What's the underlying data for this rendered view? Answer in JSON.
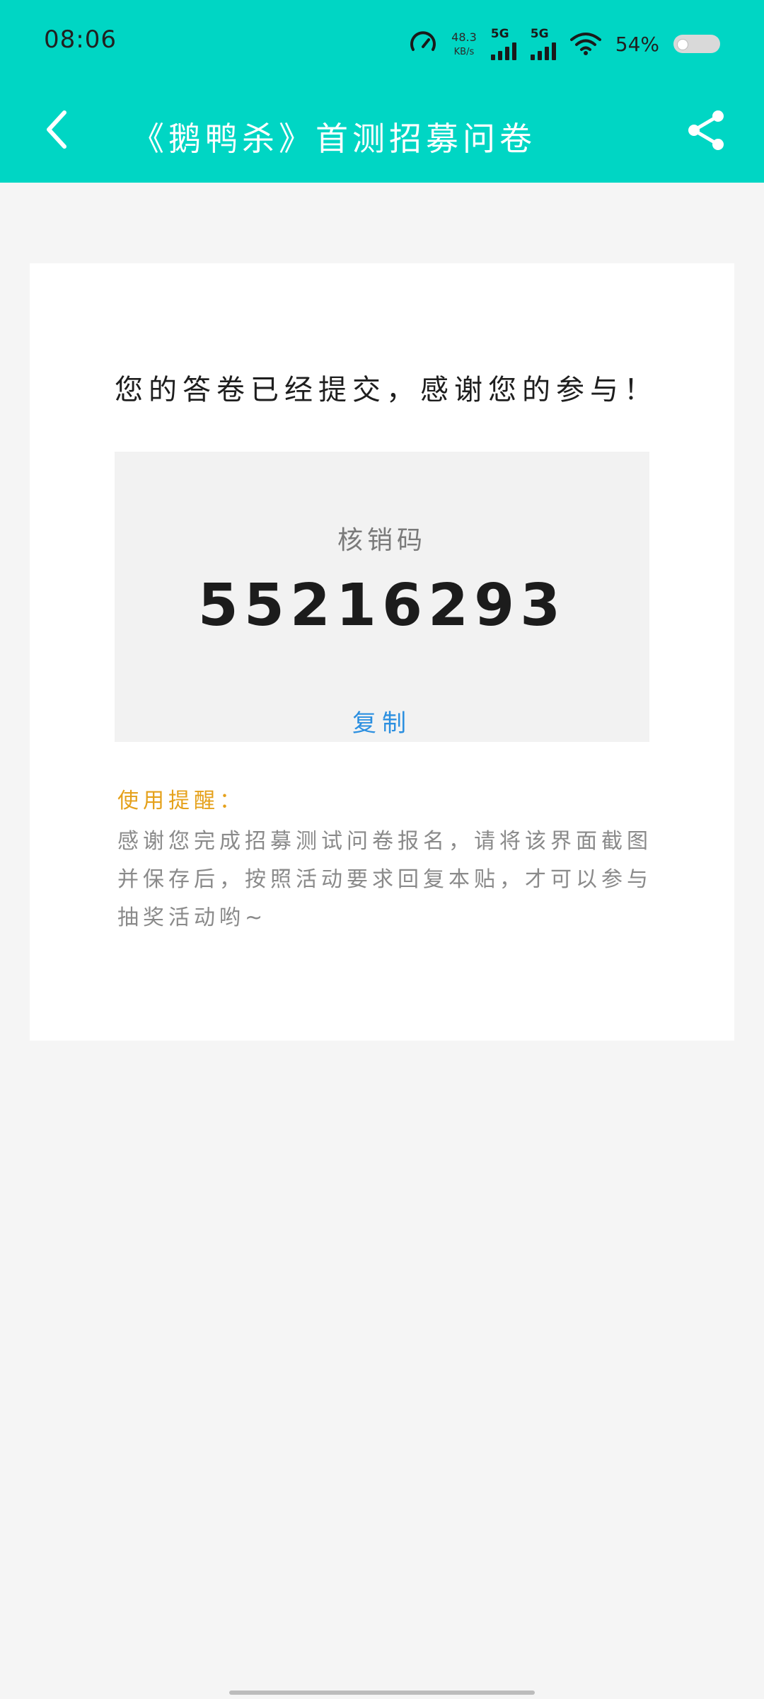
{
  "status_bar": {
    "time": "08:06",
    "net_speed_value": "48.3",
    "net_speed_unit": "KB/s",
    "signal_1_label": "5G",
    "signal_2_label": "5G",
    "battery_percent": "54%",
    "icons": [
      "speedometer-icon",
      "signal-icon",
      "wifi-icon",
      "battery-toggle"
    ]
  },
  "app_bar": {
    "title": "《鹅鸭杀》首测招募问卷",
    "icons": [
      "back-arrow-icon",
      "share-icon"
    ]
  },
  "colors": {
    "header_bg": "#00d6c4",
    "copy_link": "#2b8fe0",
    "tip_title": "#e5a11b",
    "page_bg": "#f5f5f5"
  },
  "result": {
    "message": "您的答卷已经提交，感谢您的参与！",
    "code_label": "核销码",
    "code_value": "55216293",
    "copy_label": "复制"
  },
  "tips": {
    "title": "使用提醒：",
    "text": "感谢您完成招募测试问卷报名，请将该界面截图并保存后，按照活动要求回复本贴，才可以参与抽奖活动哟~"
  }
}
